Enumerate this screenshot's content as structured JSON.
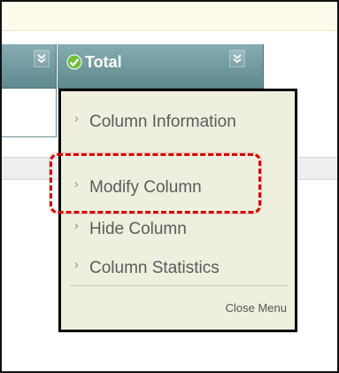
{
  "grid": {
    "columns": [
      {
        "label": "",
        "menu_icon": "chevron-double-down-icon"
      },
      {
        "label": "Total",
        "status_icon": "checkmark-icon",
        "menu_icon": "chevron-double-down-icon"
      }
    ]
  },
  "context_menu": {
    "items": [
      {
        "label": "Column Information",
        "icon": "chevron-right-icon"
      },
      {
        "label": "Modify Column",
        "icon": "chevron-right-icon",
        "highlighted": true
      },
      {
        "label": "Hide Column",
        "icon": "chevron-right-icon"
      },
      {
        "label": "Column Statistics",
        "icon": "chevron-right-icon"
      }
    ],
    "close_label": "Close Menu"
  },
  "colors": {
    "header_teal": "#6d969b",
    "menu_background": "#efefdf",
    "top_strip": "#fdfbec",
    "highlight_red": "#d10000",
    "check_green": "#6fbf3a"
  }
}
